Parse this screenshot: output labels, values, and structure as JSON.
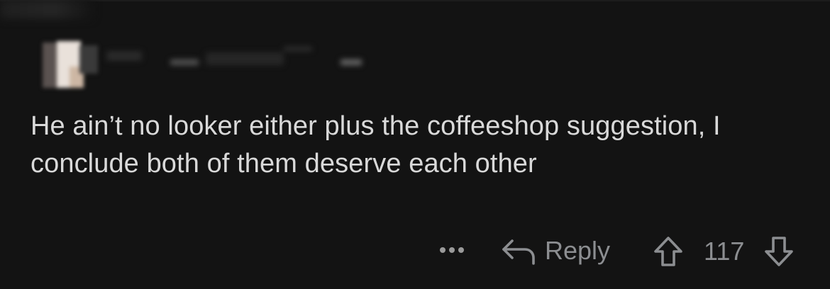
{
  "comment": {
    "body": "He ain’t no looker either plus the coffeeshop suggestion, I conclude both of them deserve each other"
  },
  "actions": {
    "more_icon": "more-horizontal-icon",
    "reply_icon": "reply-arrow-icon",
    "reply_label": "Reply",
    "upvote_icon": "upvote-arrow-icon",
    "vote_count": "117",
    "downvote_icon": "downvote-arrow-icon"
  },
  "colors": {
    "background": "#131313",
    "text": "#d9d9d9",
    "muted": "#8c8e91"
  }
}
